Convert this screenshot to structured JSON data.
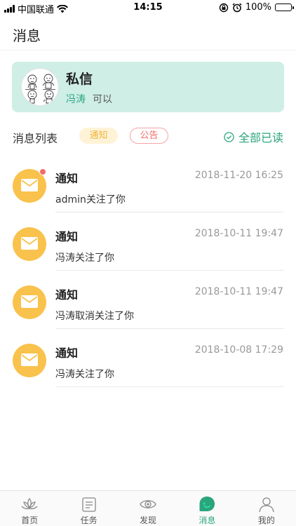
{
  "status_bar": {
    "carrier": "中国联通",
    "time": "14:15",
    "battery": "100%"
  },
  "header": {
    "title": "消息"
  },
  "dm": {
    "title": "私信",
    "sender": "冯涛",
    "message": "可以"
  },
  "list_header": {
    "title": "消息列表",
    "tag_notice": "通知",
    "tag_announce": "公告",
    "mark_all_read": "全部已读"
  },
  "messages": [
    {
      "title": "通知",
      "time": "2018-11-20 16:25",
      "text": "admin关注了你",
      "unread": true
    },
    {
      "title": "通知",
      "time": "2018-10-11 19:47",
      "text": "冯涛关注了你",
      "unread": false
    },
    {
      "title": "通知",
      "time": "2018-10-11 19:47",
      "text": "冯涛取消关注了你",
      "unread": false
    },
    {
      "title": "通知",
      "time": "2018-10-08 17:29",
      "text": "冯涛关注了你",
      "unread": false
    }
  ],
  "tabs": [
    {
      "label": "首页",
      "icon": "lotus-icon",
      "active": false
    },
    {
      "label": "任务",
      "icon": "task-icon",
      "active": false
    },
    {
      "label": "发现",
      "icon": "eye-icon",
      "active": false
    },
    {
      "label": "消息",
      "icon": "message-icon",
      "active": true
    },
    {
      "label": "我的",
      "icon": "person-icon",
      "active": false
    }
  ],
  "colors": {
    "accent": "#2aa57d",
    "dm_card_bg": "#cfeee6",
    "notice_icon": "#f9c24c",
    "unread_dot": "#f36b6b"
  }
}
